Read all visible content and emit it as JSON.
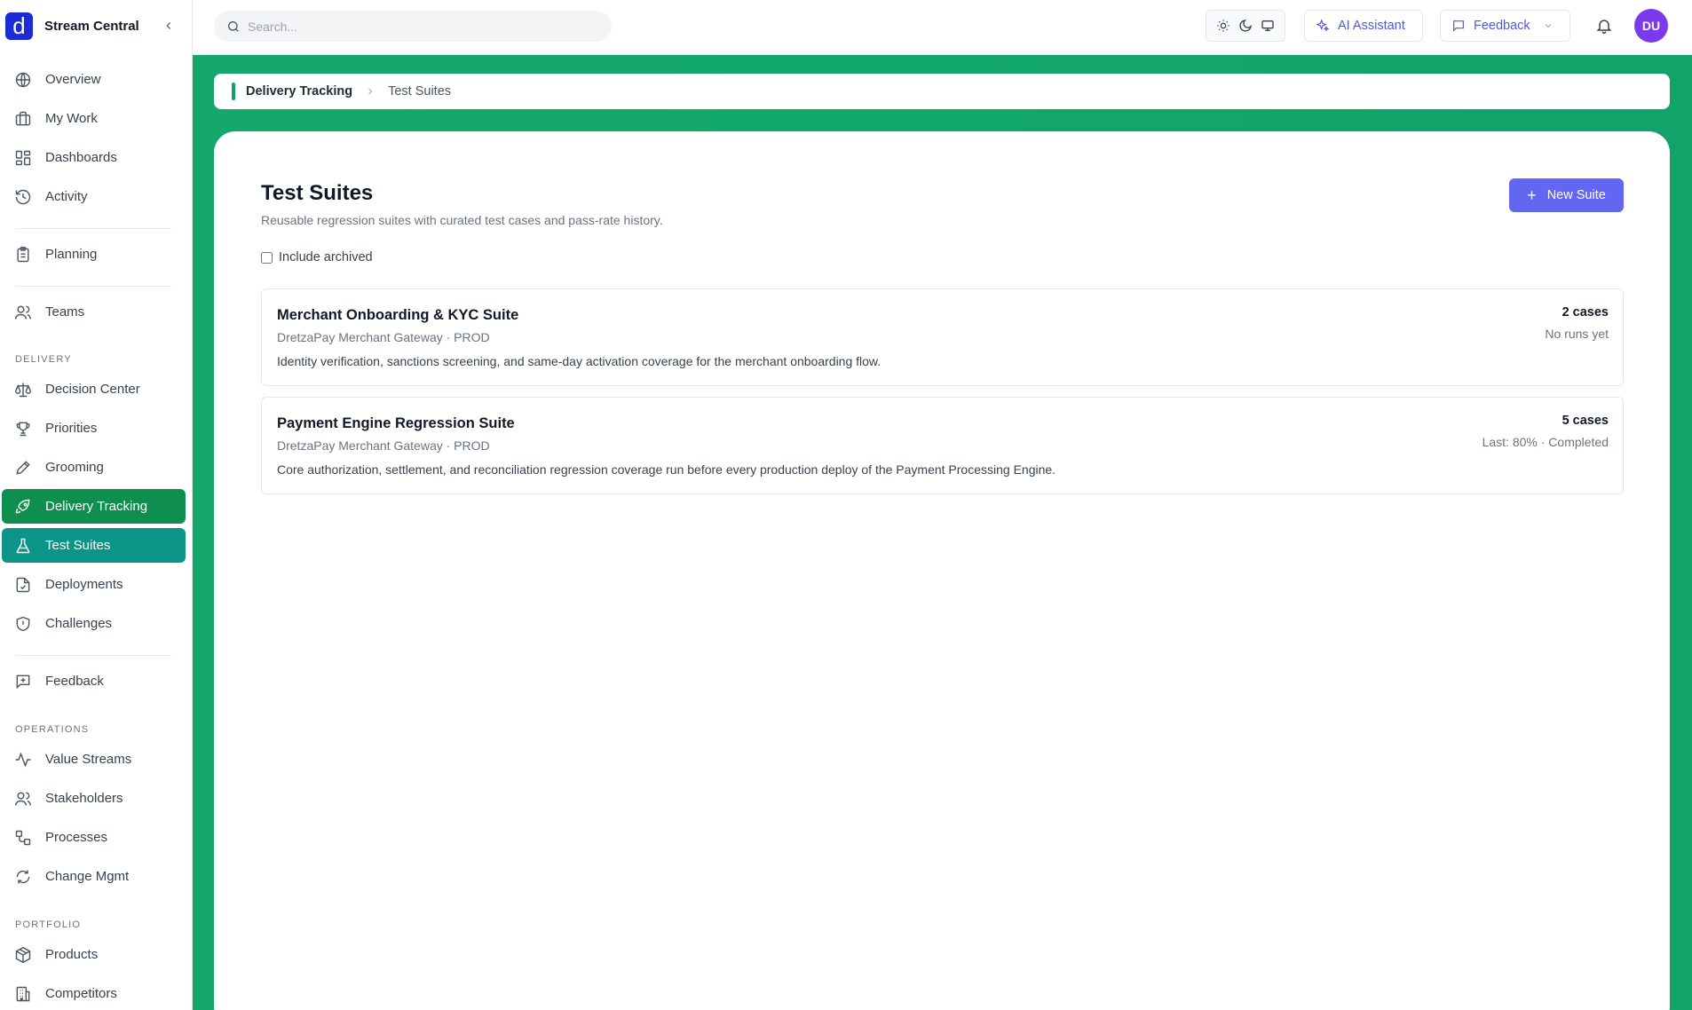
{
  "brand": {
    "logo_letter": "d",
    "name": "Stream Central",
    "logo_color": "#1d2bd6"
  },
  "sidebar": {
    "items_top": [
      {
        "label": "Overview",
        "icon": "globe-icon"
      },
      {
        "label": "My Work",
        "icon": "briefcase-icon"
      },
      {
        "label": "Dashboards",
        "icon": "grid-icon"
      },
      {
        "label": "Activity",
        "icon": "history-icon"
      }
    ],
    "planning": {
      "label": "Planning",
      "icon": "clipboard-icon"
    },
    "teams": {
      "label": "Teams",
      "icon": "users-icon"
    },
    "section_delivery": "DELIVERY",
    "delivery_items": [
      {
        "label": "Decision Center",
        "icon": "scale-icon"
      },
      {
        "label": "Priorities",
        "icon": "trophy-icon"
      },
      {
        "label": "Grooming",
        "icon": "pencil-icon"
      },
      {
        "label": "Delivery Tracking",
        "icon": "rocket-icon"
      },
      {
        "label": "Test Suites",
        "icon": "flask-icon"
      },
      {
        "label": "Deployments",
        "icon": "file-check-icon"
      },
      {
        "label": "Challenges",
        "icon": "shield-alert-icon"
      }
    ],
    "feedback": {
      "label": "Feedback",
      "icon": "message-plus-icon"
    },
    "section_operations": "OPERATIONS",
    "operations_items": [
      {
        "label": "Value Streams",
        "icon": "activity-icon"
      },
      {
        "label": "Stakeholders",
        "icon": "users-icon"
      },
      {
        "label": "Processes",
        "icon": "workflow-icon"
      },
      {
        "label": "Change Mgmt",
        "icon": "refresh-icon"
      }
    ],
    "section_portfolio": "PORTFOLIO",
    "portfolio_items": [
      {
        "label": "Products",
        "icon": "package-icon"
      },
      {
        "label": "Competitors",
        "icon": "building-icon"
      }
    ]
  },
  "topbar": {
    "search_placeholder": "Search...",
    "ai_assistant_label": "AI Assistant",
    "feedback_label": "Feedback",
    "avatar_initials": "DU"
  },
  "breadcrumb": {
    "parent": "Delivery Tracking",
    "current": "Test Suites"
  },
  "page": {
    "title": "Test Suites",
    "subtitle": "Reusable regression suites with curated test cases and pass-rate history.",
    "new_button_label": "New Suite",
    "include_archived_label": "Include archived"
  },
  "suites": [
    {
      "title": "Merchant Onboarding & KYC Suite",
      "meta": "DretzaPay Merchant Gateway · PROD",
      "description": "Identity verification, sanctions screening, and same-day activation coverage for the merchant onboarding flow.",
      "cases": "2 cases",
      "status": "No runs yet"
    },
    {
      "title": "Payment Engine Regression Suite",
      "meta": "DretzaPay Merchant Gateway · PROD",
      "description": "Core authorization, settlement, and reconciliation regression coverage run before every production deploy of the Payment Processing Engine.",
      "cases": "5 cases",
      "status": "Last: 80% · Completed"
    }
  ],
  "colors": {
    "accent_green": "#12a76a",
    "active_parent": "#0f8f4f",
    "active_item": "#0d9488",
    "primary_button": "#6366f1",
    "avatar": "#7c3aed"
  }
}
